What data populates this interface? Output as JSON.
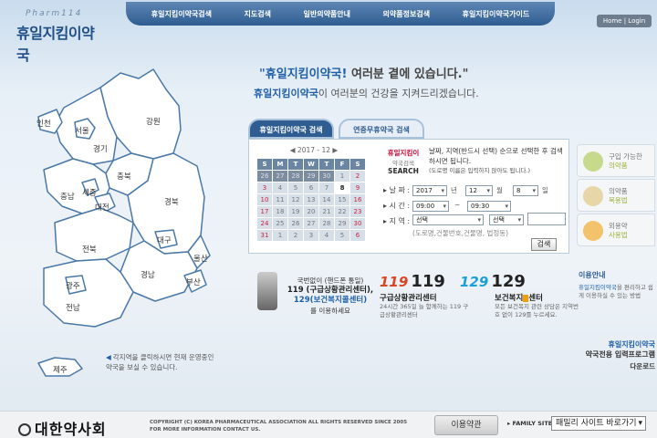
{
  "header": {
    "logo_sub": "Pharm114",
    "logo_main": "휴일지킴이약국",
    "nav": [
      "휴일지킴이약국검색",
      "지도검색",
      "일반의약품안내",
      "의약품정보검색",
      "휴일지킴이약국가이드"
    ],
    "home": "Home",
    "join": "Login"
  },
  "map": {
    "regions": [
      "인천",
      "서울",
      "경기",
      "강원",
      "충북",
      "충남",
      "세종",
      "대전",
      "경북",
      "대구",
      "전북",
      "울산",
      "경남",
      "부산",
      "광주",
      "전남",
      "제주"
    ],
    "note": "각지역을 클릭하시면 현재 운영중인 약국을 보실 수 있습니다."
  },
  "slogan": {
    "open": "\"",
    "brand": "휴일지킴이약국",
    "bang": "!",
    "rest": " 여러분 곁에 있습니다.\"",
    "line2_brand": "휴일지킴이약국",
    "line2_rest": "이 여러분의 건강을 지켜드리겠습니다."
  },
  "tabs": {
    "active": "휴일지킴이약국 검색",
    "inactive": "연중무휴약국 검색"
  },
  "calendar": {
    "header": "◀ 2017 - 12 ▶",
    "dows": [
      "S",
      "M",
      "T",
      "W",
      "T",
      "F",
      "S"
    ],
    "days": [
      "26",
      "27",
      "28",
      "29",
      "30",
      "1",
      "2",
      "3",
      "4",
      "5",
      "6",
      "7",
      "8",
      "9",
      "10",
      "11",
      "12",
      "13",
      "14",
      "15",
      "16",
      "17",
      "18",
      "19",
      "20",
      "21",
      "22",
      "23",
      "24",
      "25",
      "26",
      "27",
      "28",
      "29",
      "30",
      "31",
      "1",
      "2",
      "3",
      "4",
      "5",
      "6"
    ]
  },
  "search": {
    "badge_l1": "휴일지킴이",
    "badge_l2": "약국검색",
    "badge_l3": "SEARCH",
    "desc": "날짜, 지역(반드시 선택) 순으로 선택한 후 검색하시면 됩니다.",
    "desc_note": "(도로명 이름은 입력하지 않아도 됩니다.)",
    "date_label": "날 짜",
    "year": "2017",
    "year_unit": "년",
    "month": "12",
    "month_unit": "월",
    "day": "8",
    "day_unit": "일",
    "time_label": "시 간",
    "time_from": "09:00",
    "time_sep": "~",
    "time_to": "09:30",
    "region_label": "지 역",
    "sido": "선택",
    "gugun": "선택",
    "addr_hint": "(도로명,건물번호,건물명, 법정동)",
    "button": "검색"
  },
  "side": {
    "box1_l1": "구입 가능한",
    "box1_l2": "의약품",
    "box2_l1": "의약품",
    "box2_l2": "복용법",
    "box3_l1": "외용약",
    "box3_l2": "사용법"
  },
  "hotlines": {
    "h1_l1": "국번없이 (핸드폰 통일)",
    "h1_l2": "119 (구급상황관리센터),",
    "h1_l3": "129(보건복지콜센터)",
    "h1_l4": "를 이용하세요",
    "h2_logo": "119",
    "h2_num": "119",
    "h2_name": "구급상황관리센터",
    "h2_desc": "24시간 365일 늘 함께하는 119 구급상황관리센터",
    "h3_logo": "129",
    "h3_num": "129",
    "h3_name_a": "보건복지",
    "h3_name_b": "센터",
    "h3_desc": "모든 보건복지 관련 상담은 지역번호 없이 129를 누르세요."
  },
  "usage": {
    "title": "이용안내",
    "text_a": "휴일지킴이약국",
    "text_b": "을 편리하고 쉽게 이용하실 수 있는 방법"
  },
  "download": {
    "l1": "휴일지킴이약국",
    "l2": "약국전용 입력프로그램",
    "btn": "다운로드"
  },
  "footer": {
    "logo": "대한약사회",
    "copyright1": "COPYRIGHT (C) KOREA PHARMACEUTICAL ASSOCIATION ALL RIGHTS RESERVED SINCE 2005",
    "copyright2": "FOR MORE INFORMATION CONTACT US.",
    "terms": "이용약관",
    "family_label": "FAMILY SITE",
    "family_value": "패밀리 사이트 바로가기"
  },
  "colors": {
    "nav_bg": "#2f5d91",
    "accent_blue": "#1f5fa8",
    "map_fill": "#ffffff",
    "map_stroke": "#4a78a8"
  }
}
